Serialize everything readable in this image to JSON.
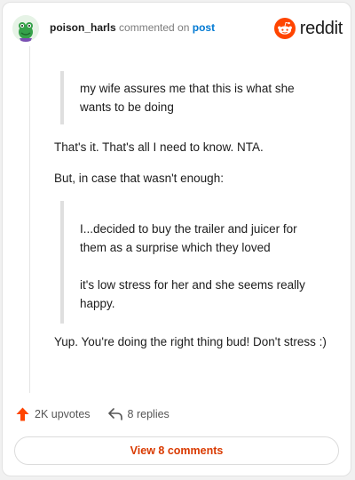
{
  "header": {
    "username": "poison_harls",
    "action_text": "commented on",
    "target_text": "post",
    "brand_text": "reddit",
    "avatar_icon": "frog-avatar-icon",
    "brand_icon": "reddit-alien-icon"
  },
  "comment": {
    "quote_1": [
      "my wife assures me that this is what she wants to be doing"
    ],
    "para_1": "That's it. That's all I need to know. NTA.",
    "para_2": "But, in case that wasn't enough:",
    "quote_2": [
      "I...decided to buy the trailer and juicer for them as a surprise which they loved",
      "it's low stress for her and she seems really happy."
    ],
    "para_3": "Yup. You're doing the right thing bud! Don't stress :)"
  },
  "actions": {
    "upvotes": "2K upvotes",
    "replies": "8 replies",
    "upvote_icon": "upvote-arrow-icon",
    "reply_icon": "reply-arrow-icon"
  },
  "footer": {
    "view_comments": "View 8 comments"
  },
  "colors": {
    "brand_orange": "#ff4500",
    "link_blue": "#0079d3",
    "cta_orange": "#d93a00"
  }
}
